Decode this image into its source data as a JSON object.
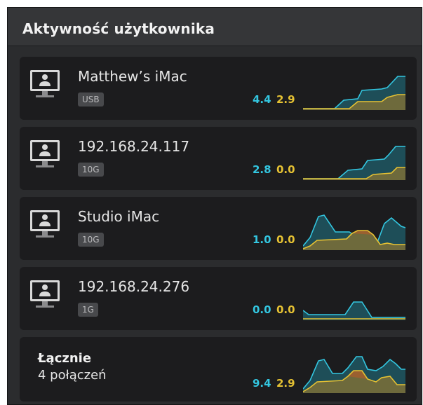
{
  "panel": {
    "title": "Aktywność użytkownika"
  },
  "colors": {
    "read": "#33c6e0",
    "write": "#e6c233"
  },
  "connections": [
    {
      "name": "Matthew’s iMac",
      "badge": "USB",
      "read": "4.4",
      "write": "2.9",
      "icon": "computer-user-icon"
    },
    {
      "name": "192.168.24.117",
      "badge": "10G",
      "read": "2.8",
      "write": "0.0",
      "icon": "computer-user-icon"
    },
    {
      "name": "Studio iMac",
      "badge": "10G",
      "read": "1.0",
      "write": "0.0",
      "icon": "computer-user-icon"
    },
    {
      "name": "192.168.24.276",
      "badge": "1G",
      "read": "0.0",
      "write": "0.0",
      "icon": "computer-user-icon"
    }
  ],
  "total": {
    "label": "Łącznie",
    "sub": "4 połączeń",
    "read": "9.4",
    "write": "2.9"
  }
}
